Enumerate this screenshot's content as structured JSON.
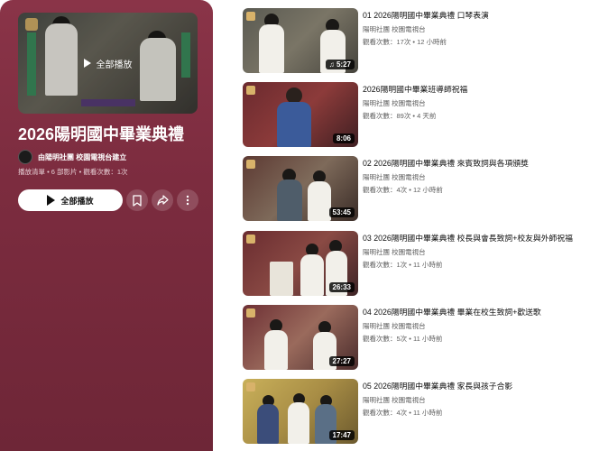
{
  "playlist": {
    "cover_overlay_label": "全部播放",
    "title": "2026陽明國中畢業典禮",
    "owner": "由陽明社團 校園電視台建立",
    "meta": "播放清單 • 6 部影片 • 觀看次數：1次",
    "play_all_label": "全部播放",
    "icons": {
      "save": "bookmark-icon",
      "share": "share-icon",
      "more": "more-vertical-icon"
    }
  },
  "videos": [
    {
      "title": "01 2026陽明國中畢業典禮 口琴表演",
      "channel": "陽明社團 校園電視台",
      "stats": "觀看次數：17次 • 12 小時前",
      "duration": "5:27",
      "duration_icon": "shorts-music-icon"
    },
    {
      "title": "2026陽明國中畢業班導師祝福",
      "channel": "陽明社團 校園電視台",
      "stats": "觀看次數：89次 • 4 天前",
      "duration": "8:06"
    },
    {
      "title": "02 2026陽明國中畢業典禮 來賓致詞與各項頒獎",
      "channel": "陽明社團 校園電視台",
      "stats": "觀看次數：4次 • 12 小時前",
      "duration": "53:45"
    },
    {
      "title": "03 2026陽明國中畢業典禮 校長與會長致詞+校友與外師祝福",
      "channel": "陽明社團 校園電視台",
      "stats": "觀看次數：1次 • 11 小時前",
      "duration": "26:33"
    },
    {
      "title": "04 2026陽明國中畢業典禮 畢業在校生致詞+歡送歌",
      "channel": "陽明社團 校園電視台",
      "stats": "觀看次數：5次 • 11 小時前",
      "duration": "27:27"
    },
    {
      "title": "05 2026陽明國中畢業典禮 家長與孩子合影",
      "channel": "陽明社團 校園電視台",
      "stats": "觀看次數：4次 • 11 小時前",
      "duration": "17:47"
    }
  ]
}
